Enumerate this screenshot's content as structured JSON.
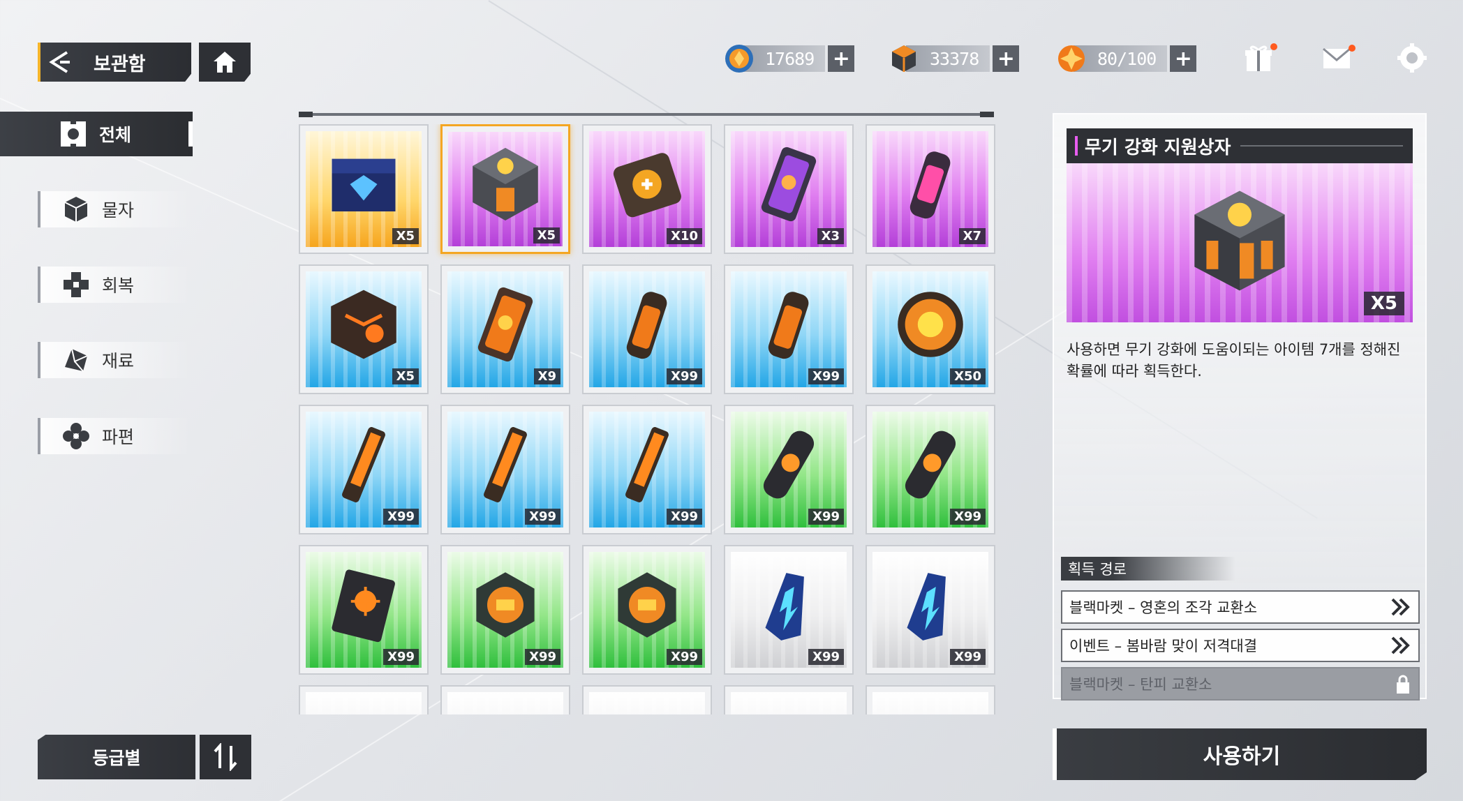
{
  "header": {
    "title": "보관함",
    "back_icon": "back-arrow-icon",
    "home_icon": "home-icon"
  },
  "currencies": [
    {
      "name": "crystal",
      "value": "17689",
      "icon": "blue-orange-gem-icon"
    },
    {
      "name": "cube",
      "value": "33378",
      "icon": "cube-currency-icon"
    },
    {
      "name": "stamina",
      "value": "80/100",
      "icon": "orange-energy-icon"
    }
  ],
  "top_icons": [
    "gift-icon",
    "mail-icon",
    "settings-icon"
  ],
  "sidebar": {
    "items": [
      {
        "label": "전체",
        "icon": "all-grid-icon",
        "active": true
      },
      {
        "label": "물자",
        "icon": "cube-icon",
        "active": false
      },
      {
        "label": "회복",
        "icon": "plus-cross-icon",
        "active": false
      },
      {
        "label": "재료",
        "icon": "material-shape-icon",
        "active": false
      },
      {
        "label": "파편",
        "icon": "fragment-flower-icon",
        "active": false
      }
    ],
    "sort_label": "등급별",
    "sort_icon": "sort-arrows-icon"
  },
  "inventory": [
    {
      "rarity": "gold",
      "qty": "X5",
      "icon": "tech-chest-icon"
    },
    {
      "rarity": "purple",
      "qty": "X5",
      "icon": "weapon-supply-cube-icon"
    },
    {
      "rarity": "purple",
      "qty": "X10",
      "icon": "orange-core-box-icon"
    },
    {
      "rarity": "purple",
      "qty": "X3",
      "icon": "purple-card-icon"
    },
    {
      "rarity": "purple",
      "qty": "X7",
      "icon": "pink-canister-icon"
    },
    {
      "rarity": "blue",
      "qty": "X5",
      "icon": "glowing-cube-icon"
    },
    {
      "rarity": "blue",
      "qty": "X9",
      "icon": "orange-card-icon"
    },
    {
      "rarity": "blue",
      "qty": "X99",
      "icon": "orange-canister-icon"
    },
    {
      "rarity": "blue",
      "qty": "X99",
      "icon": "orange-canister-icon"
    },
    {
      "rarity": "blue",
      "qty": "X50",
      "icon": "orange-orb-icon"
    },
    {
      "rarity": "blue",
      "qty": "X99",
      "icon": "orange-rod-icon"
    },
    {
      "rarity": "blue",
      "qty": "X99",
      "icon": "orange-rod-icon"
    },
    {
      "rarity": "blue",
      "qty": "X99",
      "icon": "orange-rod-icon"
    },
    {
      "rarity": "green",
      "qty": "X99",
      "icon": "black-capsule-icon"
    },
    {
      "rarity": "green",
      "qty": "X99",
      "icon": "black-capsule-icon"
    },
    {
      "rarity": "green",
      "qty": "X99",
      "icon": "black-plate-icon"
    },
    {
      "rarity": "green",
      "qty": "X99",
      "icon": "circuit-chip-icon"
    },
    {
      "rarity": "green",
      "qty": "X99",
      "icon": "circuit-chip-icon"
    },
    {
      "rarity": "white",
      "qty": "X99",
      "icon": "blue-crystal-vial-icon"
    },
    {
      "rarity": "white",
      "qty": "X99",
      "icon": "blue-crystal-vial-icon"
    },
    {
      "rarity": "white",
      "qty": "",
      "icon": ""
    },
    {
      "rarity": "white",
      "qty": "",
      "icon": ""
    },
    {
      "rarity": "white",
      "qty": "",
      "icon": ""
    },
    {
      "rarity": "white",
      "qty": "",
      "icon": ""
    },
    {
      "rarity": "white",
      "qty": "",
      "icon": ""
    }
  ],
  "detail": {
    "title": "무기 강화 지원상자",
    "qty": "X5",
    "image_icon": "weapon-supply-cube-icon",
    "description": "사용하면 무기 강화에 도움이되는 아이템 7개를 정해진 확률에 따라 획득한다.",
    "acquire_title": "획득 경로",
    "acquire_routes": [
      {
        "label": "블랙마켓 – 영혼의 조각 교환소",
        "locked": false
      },
      {
        "label": "이벤트 – 봄바람 맞이 저격대결",
        "locked": false
      },
      {
        "label": "블랙마켓 – 탄피 교환소",
        "locked": true
      }
    ],
    "use_label": "사용하기"
  },
  "colors": {
    "accent_gold": "#f4a623",
    "panel_dark": "#2e3035",
    "rarity_gold": "#f6a51e",
    "rarity_purple": "#c14fe0",
    "rarity_blue": "#23a6e6",
    "rarity_green": "#2fbf3d",
    "rarity_white": "#cfd0d3",
    "notify_dot": "#ff5a1f"
  }
}
